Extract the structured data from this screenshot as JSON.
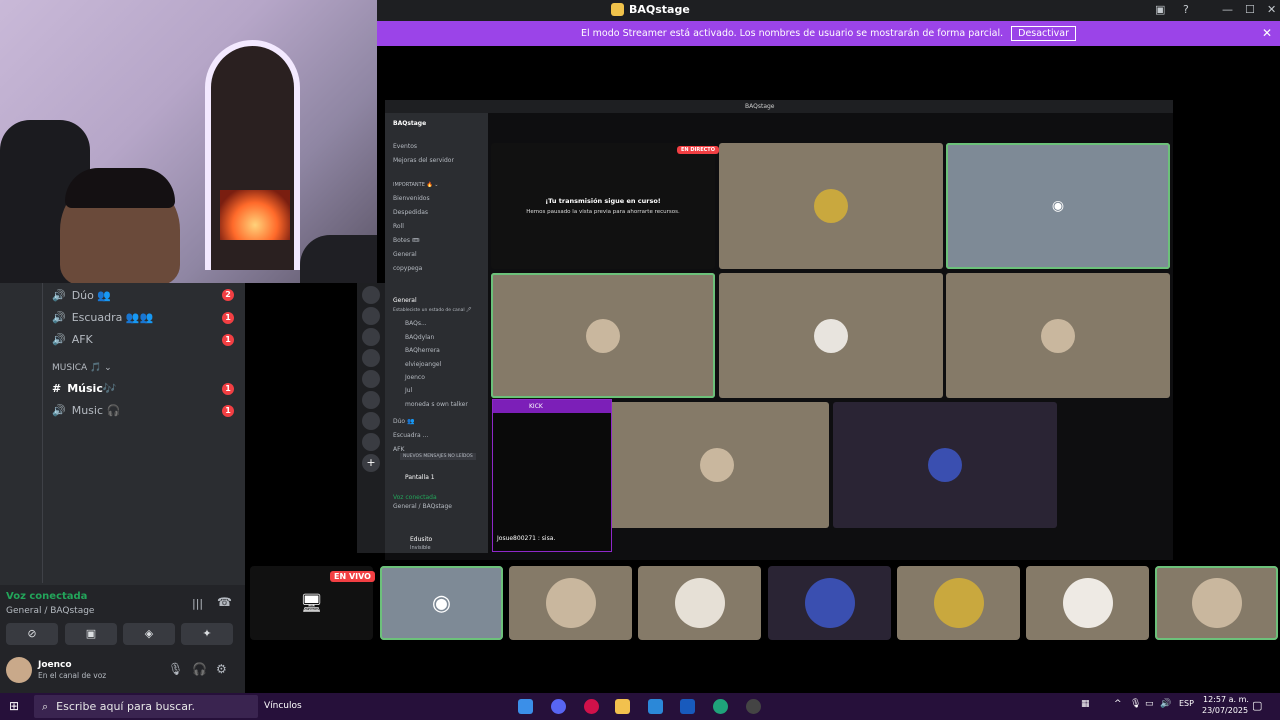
{
  "window": {
    "title": "BAQstage",
    "controls": {
      "min": "—",
      "max": "☐",
      "close": "✕"
    }
  },
  "banner": {
    "text": "El modo Streamer está activado. Los nombres de usuario se mostrarán de forma parcial.",
    "button": "Desactivar",
    "close": "✕"
  },
  "left_channels": [
    {
      "name": "Dúo 👥",
      "badge": "2"
    },
    {
      "name": "Escuadra 👥👥",
      "badge": "1"
    },
    {
      "name": "AFK",
      "badge": "1"
    },
    {
      "name": "MUSICA 🎵 ⌄",
      "badge": ""
    },
    {
      "name": "Músic🎶",
      "badge": "1"
    },
    {
      "name": "Music 🎧",
      "badge": "1"
    }
  ],
  "voice": {
    "status": "Voz conectada",
    "location": "General / BAQstage"
  },
  "user": {
    "name": "Joenco",
    "status": "En el canal de voz"
  },
  "mini": {
    "title": "BAQstage",
    "server": "BAQstage",
    "sidebar": [
      "Eventos",
      "Mejoras del servidor",
      "IMPORTANTE 🔥 ⌄",
      "Bienvenidos",
      "Despedidas",
      "Roll",
      "Botes 🎟",
      "General",
      "copypega",
      "General",
      "Estableciste un estado de canal 🖊",
      "BAQs...",
      "BAQdylan",
      "BAQherrera",
      "elviejoangel",
      "Joenco",
      "Jul",
      "moneda s own talker",
      "Dúo 👥",
      "Escuadra ...",
      "AFK"
    ],
    "unread": "NUEVOS MENSAJES NO LEÍDOS",
    "screen": "Pantalla 1",
    "voice_status": "Voz conectada",
    "voice_loc": "General / BAQstage",
    "user": "Edusito",
    "user_status": "Invisible",
    "live": "EN DIRECTO",
    "notice_title": "¡Tu transmisión sigue en curso!",
    "notice_sub": "Hemos pausado la vista previa para ahorrarte recursos."
  },
  "kick": {
    "title": "KICK",
    "message": "Josue800271 : sisa."
  },
  "bottom": {
    "live": "EN VIVO"
  },
  "taskbar": {
    "search": "Escribe aquí para buscar.",
    "links": "Vínculos",
    "lang": "ESP",
    "time": "12:57 a. m.",
    "date": "23/07/2025"
  },
  "colors": {
    "banner": "#9b44e8",
    "voice_green": "#23a55a",
    "badge_red": "#f23f43"
  }
}
